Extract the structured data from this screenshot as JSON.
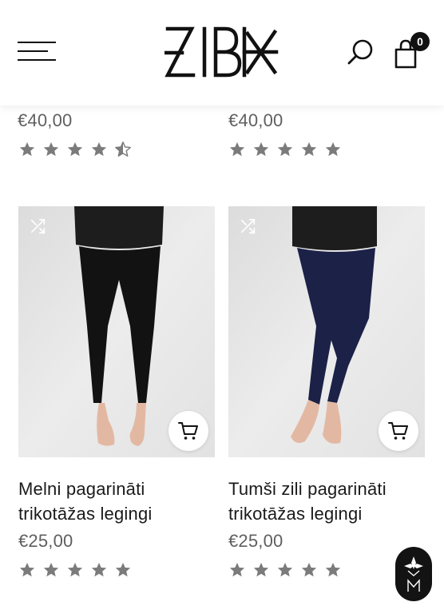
{
  "header": {
    "menu_icon": "hamburger-menu-icon",
    "logo_text": "ZIBK",
    "search_icon": "search-icon",
    "cart_icon": "shopping-bag-icon",
    "cart_count": "0"
  },
  "previous_row": [
    {
      "price": "€40,00",
      "rating": 4.5
    },
    {
      "price": "€40,00",
      "rating": 5
    }
  ],
  "products": [
    {
      "title_line1": "Melni pagarināti",
      "title_line2": "trikotāžas legingi",
      "price": "€25,00",
      "rating": 5,
      "legging_color": "#121212"
    },
    {
      "title_line1": "Tumši zili pagarināti",
      "title_line2": "trikotāžas legingi",
      "price": "€25,00",
      "rating": 5,
      "legging_color": "#1b2147"
    }
  ],
  "colors": {
    "star": "#7b7b7b",
    "price": "#5f5f5f",
    "badge": "#131313"
  }
}
